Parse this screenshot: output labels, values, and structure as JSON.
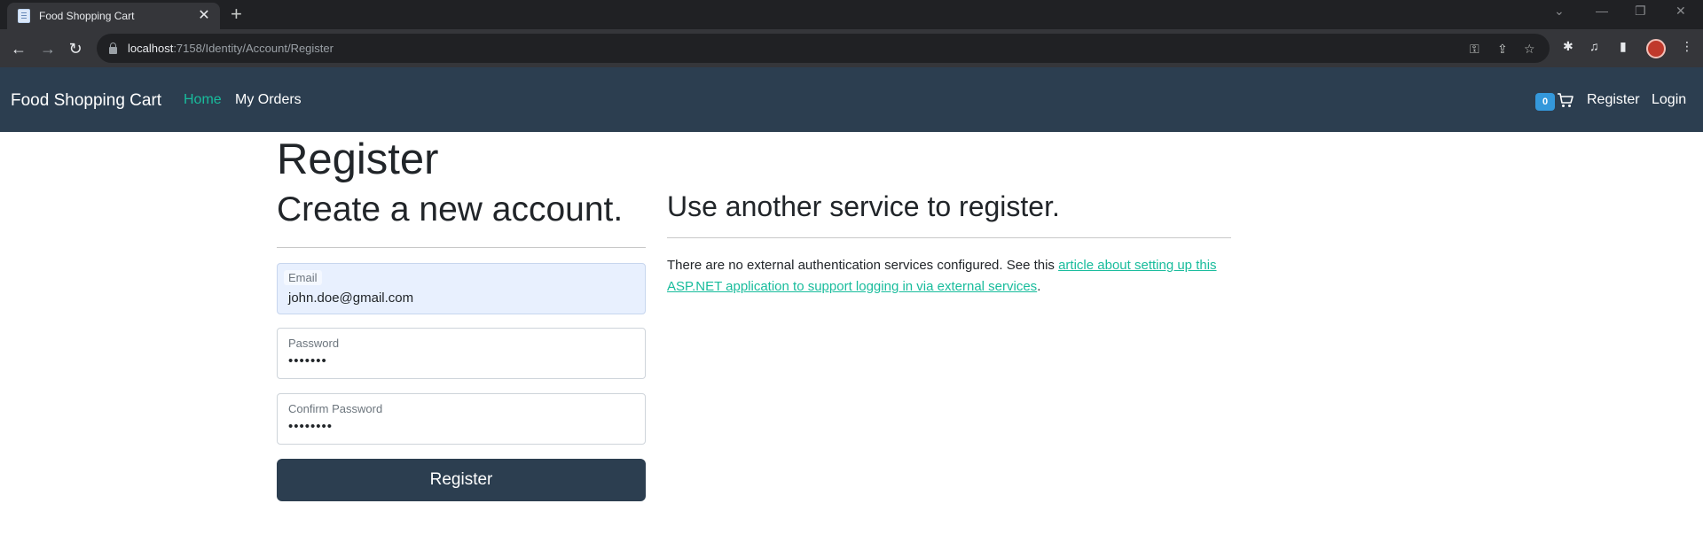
{
  "browser": {
    "tab_title": "Food Shopping Cart",
    "tab_close": "✕",
    "new_tab": "+",
    "url_host": "localhost",
    "url_path": ":7158/Identity/Account/Register"
  },
  "navbar": {
    "brand": "Food Shopping Cart",
    "home": "Home",
    "my_orders": "My Orders",
    "cart_count": "0",
    "register": "Register",
    "login": "Login"
  },
  "page": {
    "title": "Register",
    "subtitle": "Create a new account.",
    "email": {
      "label": "Email",
      "value": "john.doe@gmail.com"
    },
    "password": {
      "label": "Password",
      "value": "•••••••"
    },
    "confirm_password": {
      "label": "Confirm Password",
      "value": "••••••••"
    },
    "submit_label": "Register"
  },
  "external": {
    "heading": "Use another service to register.",
    "text": "There are no external authentication services configured. See this ",
    "link_text": "article about setting up this ASP.NET application to support logging in via external services",
    "text_end": "."
  },
  "colors": {
    "navbar_bg": "#2c3e50",
    "accent": "#18bc9c",
    "badge": "#3498db"
  }
}
